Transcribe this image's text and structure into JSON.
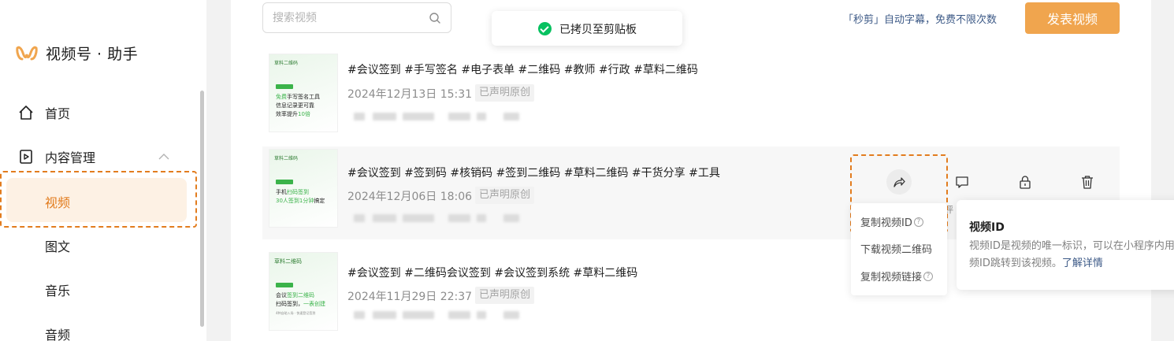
{
  "app": {
    "name": "视频号 · 助手",
    "brand_color": "#f0a54e",
    "highlight_color": "#e27c1e"
  },
  "sidebar": {
    "items": [
      {
        "label": "首页",
        "icon": "home-icon"
      },
      {
        "label": "内容管理",
        "icon": "content-icon"
      }
    ],
    "subitems": [
      {
        "label": "视频",
        "active": true
      },
      {
        "label": "图文"
      },
      {
        "label": "音乐"
      },
      {
        "label": "音频"
      }
    ]
  },
  "header": {
    "search_placeholder": "搜索视频",
    "toast": "已拷贝至剪贴板",
    "promo": "「秒剪」自动字幕，免费不限次数",
    "publish_label": "发表视频"
  },
  "videos": [
    {
      "title": "#会议签到 #手写签名 #电子表单 #二维码 #教师 #行政 #草料二维码",
      "date": "2024年12月13日 15:31",
      "badge": "已声明原创",
      "thumb": {
        "brand": "草料二维码",
        "l1a": "免费",
        "l1b": "手写签名工具",
        "l2": "信息记录更可靠",
        "l3a": "效率提升",
        "l3b": "10倍"
      }
    },
    {
      "title": "#会议签到 #签到码 #核销码 #签到二维码 #草料二维码 #干货分享 #工具",
      "date": "2024年12月06日 18:06",
      "badge": "已声明原创",
      "thumb": {
        "brand": "草料二维码",
        "l1a": "手机",
        "l1b": "扫码签到",
        "l2a": "30人签到",
        "l2b": "1分钟",
        "l2c": "搞定"
      }
    },
    {
      "title": "#会议签到 #二维码会议签到 #会议签到系统 #草料二维码",
      "date": "2024年11月29日 22:37",
      "badge": "已声明原创",
      "thumb": {
        "brand": "草料二维码",
        "l1a": "会议",
        "l1b": "签到二维码",
        "l2a": "扫码签到",
        "l2b": "，",
        "l2c": "一表创建",
        "l3": "4种自助入场 · 快速登记签到"
      }
    }
  ],
  "actions": {
    "icons": [
      "share-icon",
      "comment-icon",
      "lock-icon",
      "trash-icon"
    ],
    "dropdown": [
      "复制视频ID",
      "下载视频二维码",
      "复制视频链接"
    ],
    "partial_label": "评"
  },
  "tooltip": {
    "title": "视频ID",
    "body": "视频ID是视频的唯一标识，可以在小程序内用视频ID跳转到该视频。",
    "link": "了解详情"
  }
}
